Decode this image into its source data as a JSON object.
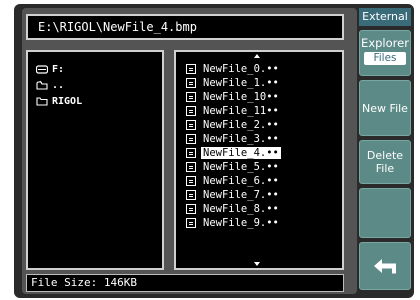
{
  "path": "E:\\RIGOL\\NewFile_4.bmp",
  "directory": [
    {
      "label": "F:",
      "icon": "drive-icon"
    },
    {
      "label": "..",
      "icon": "parent-folder-icon"
    },
    {
      "label": "RIGOL",
      "icon": "folder-icon"
    }
  ],
  "files": [
    "NewFile_0.••",
    "NewFile_1.••",
    "NewFile_10••",
    "NewFile_11••",
    "NewFile_2.••",
    "NewFile_3.••",
    "NewFile_4.••",
    "NewFile_5.••",
    "NewFile_6.••",
    "NewFile_7.••",
    "NewFile_8.••",
    "NewFile_9.••"
  ],
  "selected_file_index": 6,
  "status": "File Size: 146KB",
  "menu": {
    "title": "External",
    "explorer_label": "Explorer",
    "explorer_value": "Files",
    "new_file": "New File",
    "delete_file": "Delete File",
    "back_icon": "return-arrow-icon"
  },
  "colors": {
    "menu_accent": "#5c8a86",
    "menu_title": "#3a6b78",
    "selection": "#ffffff"
  }
}
